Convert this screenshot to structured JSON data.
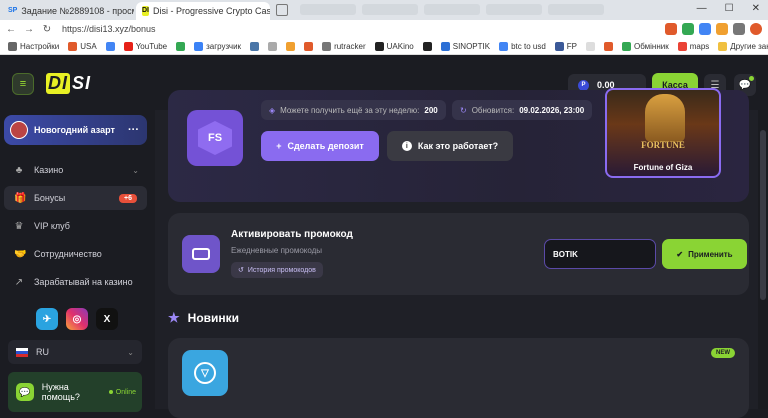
{
  "browser": {
    "tab_inactive": "Задание №2889108 - просмотр з",
    "tab_active": "Disi - Progressive Crypto Casino",
    "tab_close": "×",
    "tab_inactive_fav": "SP",
    "tab_active_fav": "DI",
    "url": "https://disi13.xyz/bonus",
    "back": "←",
    "forward": "→",
    "reload": "↻",
    "ctrl_min": "—",
    "ctrl_max": "☐",
    "ctrl_close": "✕"
  },
  "bookmarks": [
    {
      "label": "Настройки",
      "color": "#666"
    },
    {
      "label": "USA",
      "color": "#e05a2b"
    },
    {
      "label": "",
      "color": "#4285f4"
    },
    {
      "label": "YouTube",
      "color": "#e62117"
    },
    {
      "label": "",
      "color": "#34a853"
    },
    {
      "label": "загрузчик",
      "color": "#3b82f6"
    },
    {
      "label": "",
      "color": "#4a76a8"
    },
    {
      "label": "",
      "color": "#aaa"
    },
    {
      "label": "",
      "color": "#f0a030"
    },
    {
      "label": "",
      "color": "#e05a2b"
    },
    {
      "label": "rutracker",
      "color": "#777"
    },
    {
      "label": "UAKino",
      "color": "#222"
    },
    {
      "label": "",
      "color": "#222"
    },
    {
      "label": "SINOPTIK",
      "color": "#2b6fd6"
    },
    {
      "label": "btc to usd",
      "color": "#4285f4"
    },
    {
      "label": "FP",
      "color": "#3b5998"
    },
    {
      "label": "",
      "color": "#ddd"
    },
    {
      "label": "",
      "color": "#e05a2b"
    },
    {
      "label": "Обмінник",
      "color": "#34a853"
    },
    {
      "label": "maps",
      "color": "#ea4335"
    }
  ],
  "bookmarks_other": "Другие закладки",
  "header": {
    "logo_part1": "DI",
    "logo_part2": "SI",
    "balance": "0.00",
    "coin_symbol": "P",
    "kassa": "Касса",
    "menu_glyph": "☰",
    "burger_glyph": "≡",
    "chat_glyph": "💬"
  },
  "sidebar": {
    "promo": "Новогодний азарт",
    "promo_dots": "···",
    "items": [
      {
        "label": "Казино",
        "icon": "♣",
        "caret": "⌄"
      },
      {
        "label": "Бонусы",
        "icon": "🎁",
        "badge": "+6"
      },
      {
        "label": "VIP клуб",
        "icon": "♛"
      },
      {
        "label": "Сотрудничество",
        "icon": "🤝"
      },
      {
        "label": "Зарабатывай на казино",
        "icon": "↗"
      }
    ],
    "socials": [
      {
        "name": "telegram",
        "glyph": "✈",
        "color": "#2aa3e0"
      },
      {
        "name": "instagram",
        "glyph": "◎",
        "color": "#e1306c"
      },
      {
        "name": "x",
        "glyph": "X",
        "color": "#111111"
      }
    ],
    "language": "RU",
    "language_caret": "⌄",
    "help_label": "Нужна помощь?",
    "help_status": "Online",
    "help_icon": "💬"
  },
  "freespins": {
    "icon_label": "FS",
    "weekly_text": "Можете получить ещё за эту неделю:",
    "weekly_value": "200",
    "update_text": "Обновится:",
    "update_value": "09.02.2026, 23:00",
    "deposit_btn": "Сделать депозит",
    "deposit_icon": "+",
    "how_btn": "Как это работает?",
    "how_icon": "i",
    "game_logo": "FORTUNE",
    "game_title": "Fortune of Giza"
  },
  "promocode": {
    "title": "Активировать промокод",
    "subtitle": "Ежедневные промокоды",
    "history": "История промокодов",
    "history_icon": "↺",
    "input_value": "BOTIK",
    "apply_btn": "Применить",
    "apply_icon": "✔"
  },
  "new_section": {
    "title": "Новинки",
    "star": "★",
    "badge": "NEW",
    "ton_glyph": "▽"
  }
}
